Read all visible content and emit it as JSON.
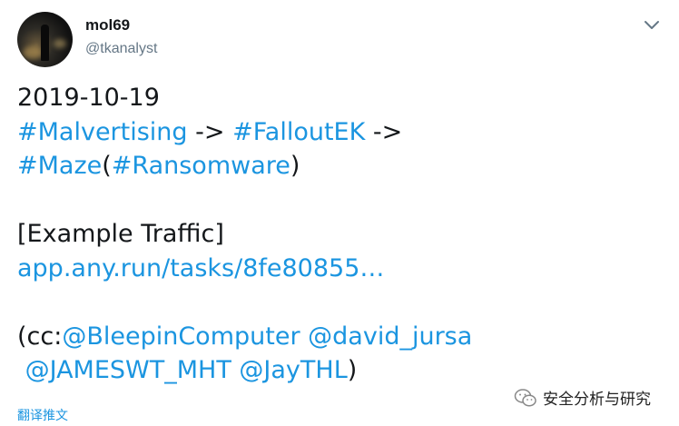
{
  "author": {
    "name": "mol69",
    "handle": "@tkanalyst"
  },
  "tweet": {
    "date": "2019-10-19",
    "tag_malvertising": "#Malvertising",
    "arrow1": " -> ",
    "tag_falloutek": "#FalloutEK",
    "arrow2": " ->",
    "tag_maze": "#Maze",
    "paren_open": "(",
    "tag_ransomware": "#Ransomware",
    "paren_close": ")",
    "example_label": "[Example Traffic]",
    "link": "app.any.run/tasks/8fe80855…",
    "cc_prefix": "(cc:",
    "mention_bleeping": "@BleepinComputer",
    "mention_david": "@david_jursa",
    "mention_jameswt": "@JAMESWT_MHT",
    "mention_jaythl": "@JayTHL",
    "cc_suffix": ")"
  },
  "actions": {
    "translate": "翻译推文"
  },
  "watermark": {
    "text": "安全分析与研究",
    "icon": "wechat-icon"
  },
  "colors": {
    "link": "#1b95e0",
    "text": "#14171a",
    "muted": "#657786"
  }
}
